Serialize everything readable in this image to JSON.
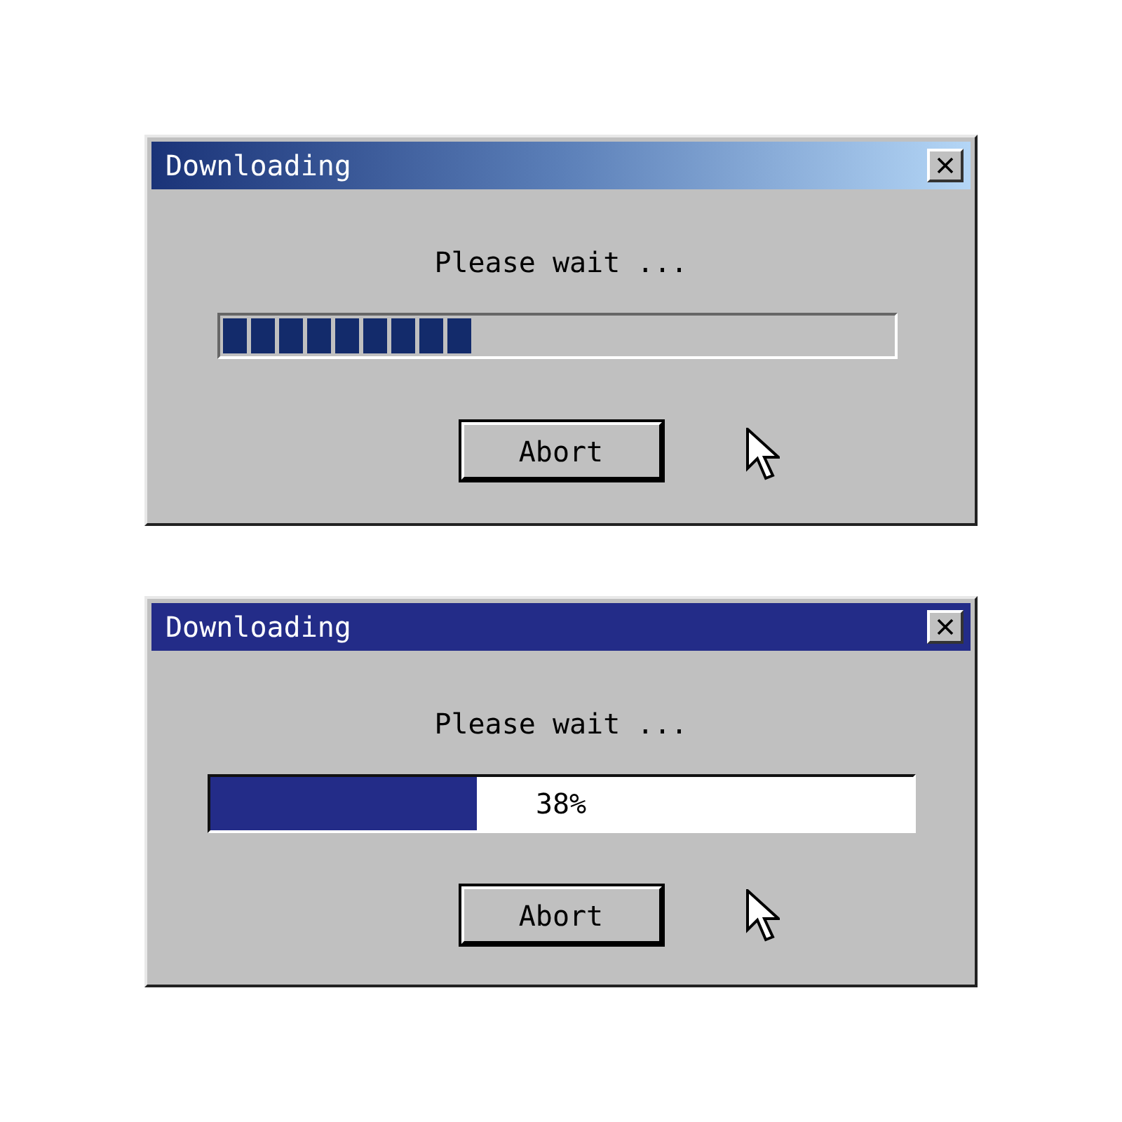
{
  "dialogs": [
    {
      "title": "Downloading",
      "kind": "gradient",
      "message": "Please wait ...",
      "progress": {
        "kind": "segmented",
        "level": 0.375
      },
      "buttons": [
        "Abort"
      ]
    },
    {
      "title": "Downloading",
      "kind": "solid",
      "message": "Please wait ...",
      "progress": {
        "kind": "solid",
        "level": 0.38,
        "reading": "38%"
      },
      "buttons": [
        "Abort"
      ]
    }
  ]
}
